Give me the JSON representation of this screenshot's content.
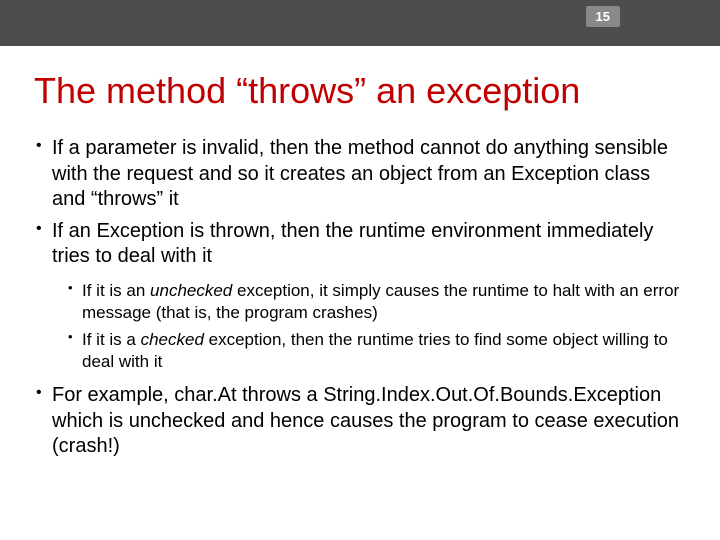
{
  "slide_number": "15",
  "title": "The method “throws” an exception",
  "bullets": {
    "b1": "If a parameter is invalid, then the method cannot do anything sensible with the request and so it creates an object from an Exception class and “throws” it",
    "b2": "If an Exception is thrown, then the runtime environment immediately tries to deal with it",
    "b2_1_pre": "If it is an ",
    "b2_1_em": "unchecked",
    "b2_1_post": " exception, it simply causes the runtime to halt with an error message (that is, the program crashes)",
    "b2_2_pre": "If it is a ",
    "b2_2_em": "checked",
    "b2_2_post": " exception, then the runtime tries to find some object willing to deal with it",
    "b3": "For example, char.At throws a String.Index.Out.Of.Bounds.Exception which is unchecked and hence causes the program to cease execution (crash!)"
  }
}
